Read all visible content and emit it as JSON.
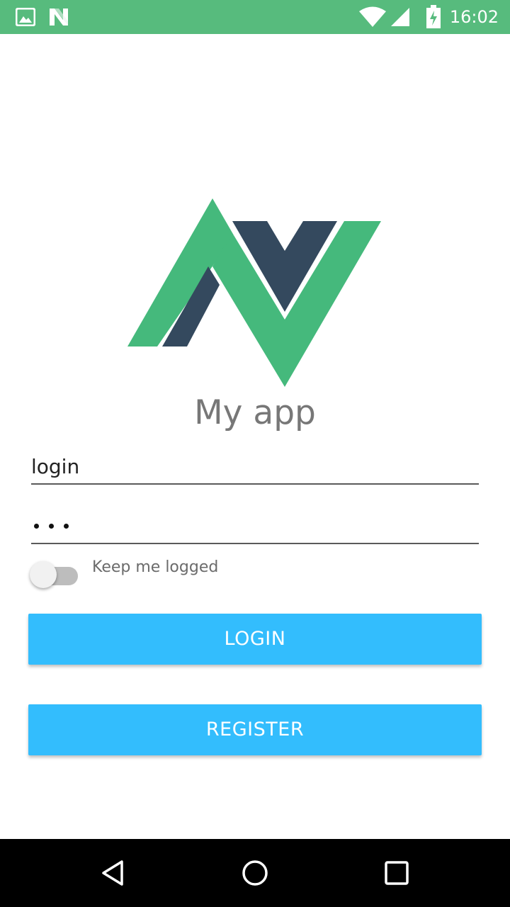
{
  "status_bar": {
    "time": "16:02",
    "background": "#57bb7d",
    "icons": [
      "image-notification-icon",
      "n-notification-icon",
      "wifi-icon",
      "signal-icon",
      "battery-charging-icon"
    ]
  },
  "app": {
    "title": "My app",
    "logo": "app-logo",
    "logo_colors": {
      "green": "#45b97c",
      "navy": "#34495e"
    }
  },
  "form": {
    "login_value": "login",
    "password_value": "•••",
    "keep_logged_label": "Keep me logged",
    "keep_logged_on": false
  },
  "buttons": {
    "login_label": "LOGIN",
    "register_label": "REGISTER",
    "color": "#33bdfd"
  },
  "nav_bar": {
    "icons": [
      "back-icon",
      "home-icon",
      "recents-icon"
    ]
  }
}
